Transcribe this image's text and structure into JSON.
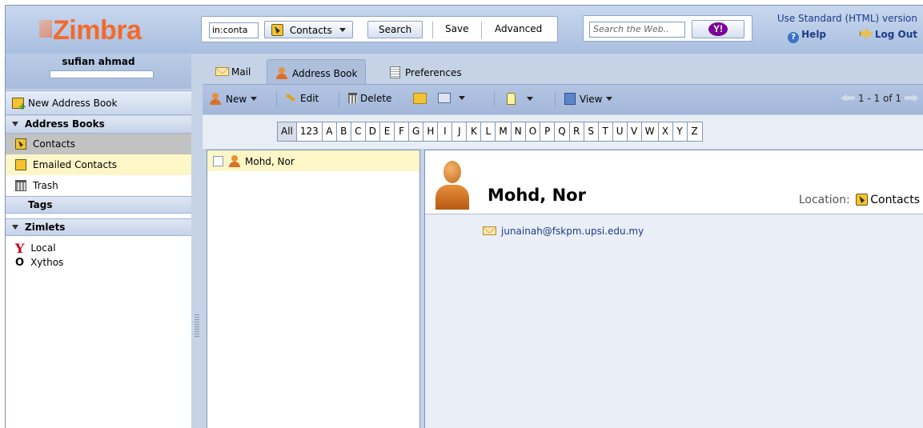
{
  "app": {
    "logo": "Zimbra"
  },
  "search": {
    "query_value": "in:conta",
    "scope_label": "Contacts",
    "search_label": "Search",
    "save_label": "Save",
    "advanced_label": "Advanced",
    "web_placeholder": "Search the Web..",
    "web_button_label": "Y!"
  },
  "header": {
    "standard_version_link": "Use Standard (HTML) version",
    "help_label": "Help",
    "logout_label": "Log Out"
  },
  "user": {
    "name": "sufian ahmad"
  },
  "sidebar": {
    "new_address_book_label": "New Address Book",
    "address_books_header": "Address Books",
    "address_books": [
      {
        "label": "Contacts",
        "icon": "address-book-icon"
      },
      {
        "label": "Emailed Contacts",
        "icon": "emailed-contacts-icon"
      },
      {
        "label": "Trash",
        "icon": "trash-icon"
      }
    ],
    "tags_header": "Tags",
    "zimlets_header": "Zimlets",
    "zimlets": [
      {
        "label": "Local",
        "icon": "yahoo-y-icon"
      },
      {
        "label": "Xythos",
        "icon": "xythos-icon"
      }
    ]
  },
  "tabs": [
    {
      "label": "Mail",
      "icon": "mail-icon"
    },
    {
      "label": "Address Book",
      "icon": "person-icon",
      "active": true
    },
    {
      "label": "Preferences",
      "icon": "preferences-icon"
    }
  ],
  "toolbar": {
    "new_label": "New",
    "edit_label": "Edit",
    "delete_label": "Delete",
    "view_label": "View",
    "pager_text": "1 - 1 of 1"
  },
  "alphabet": [
    "All",
    "123",
    "A",
    "B",
    "C",
    "D",
    "E",
    "F",
    "G",
    "H",
    "I",
    "J",
    "K",
    "L",
    "M",
    "N",
    "O",
    "P",
    "Q",
    "R",
    "S",
    "T",
    "U",
    "V",
    "W",
    "X",
    "Y",
    "Z"
  ],
  "contact_list": [
    {
      "name": "Mohd, Nor"
    }
  ],
  "contact_detail": {
    "name": "Mohd, Nor",
    "location_label": "Location:",
    "location_value": "Contacts",
    "email": "junainah@fskpm.upsi.edu.my"
  },
  "colors": {
    "brand_orange": "#f26a2c",
    "panel_blue": "#c6d3e6",
    "selection_yellow": "#fdf6c7",
    "link_blue": "#1c3d85"
  }
}
